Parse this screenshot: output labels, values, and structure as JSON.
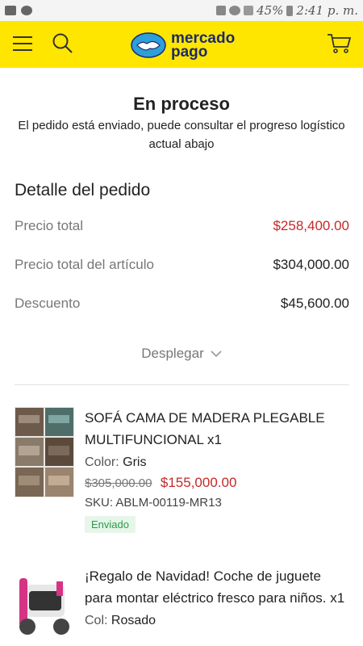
{
  "statusbar": {
    "battery": "45%",
    "time": "2:41 p. m."
  },
  "header": {
    "logo_line1": "mercado",
    "logo_line2": "pago"
  },
  "status": {
    "title": "En proceso",
    "description": "El pedido está enviado, puede consultar el progreso logístico actual abajo"
  },
  "order_detail": {
    "title": "Detalle del pedido",
    "rows": [
      {
        "label": "Precio total",
        "value": "$258,400.00"
      },
      {
        "label": "Precio total del artículo",
        "value": "$304,000.00"
      },
      {
        "label": "Descuento",
        "value": "$45,600.00"
      }
    ],
    "expand_label": "Desplegar"
  },
  "products": [
    {
      "name": "SOFÁ CAMA DE MADERA PLEGABLE MULTIFUNCIONAL x1",
      "attr_key": "Color:",
      "attr_val": "Gris",
      "old_price": "$305,000.00",
      "price": "$155,000.00",
      "sku_label": "SKU:",
      "sku": "ABLM-00119-MR13",
      "status": "Enviado"
    },
    {
      "name": "¡Regalo de Navidad! Coche de juguete para montar eléctrico fresco para niños. x1",
      "attr_key": "Col:",
      "attr_val": "Rosado"
    }
  ],
  "colors": {
    "header_bg": "#ffe600",
    "price_red": "#c62828",
    "status_green": "#2e9a47"
  }
}
